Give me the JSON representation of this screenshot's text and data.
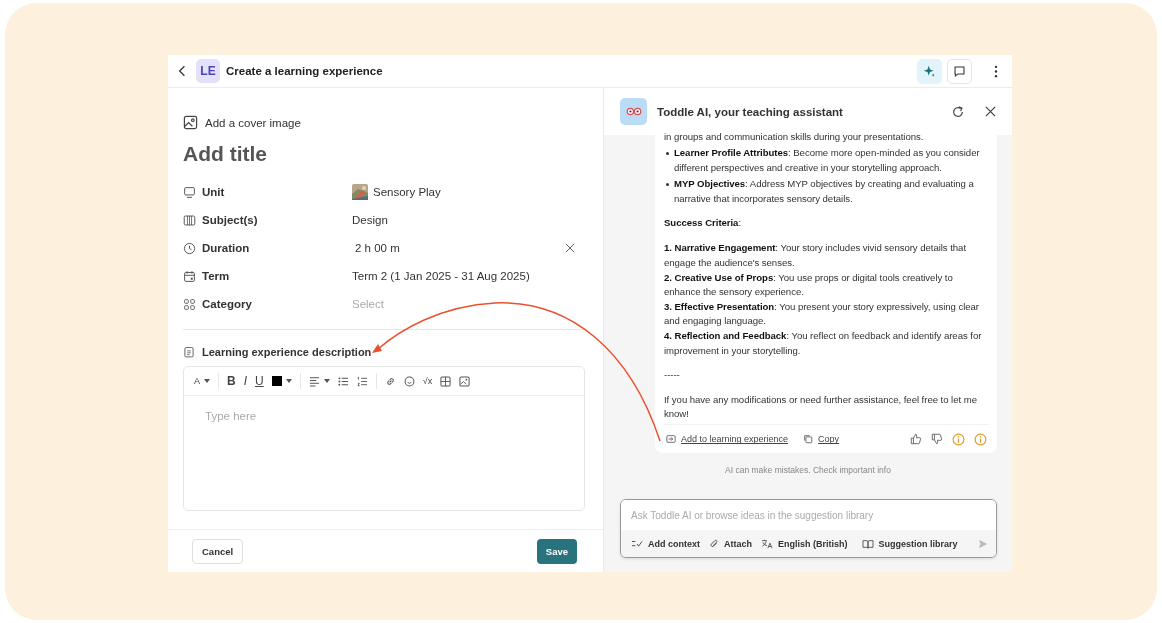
{
  "header": {
    "badge": "LE",
    "title": "Create a learning experience"
  },
  "form": {
    "cover_label": "Add a cover image",
    "title_placeholder": "Add title",
    "fields": [
      {
        "kind": "unit",
        "label": "Unit",
        "value": "Sensory Play"
      },
      {
        "kind": "subject",
        "label": "Subject(s)",
        "value": "Design"
      },
      {
        "kind": "duration",
        "label": "Duration",
        "value": "2 h 00 m"
      },
      {
        "kind": "term",
        "label": "Term",
        "value": "Term 2 (1 Jan 2025 - 31 Aug 2025)"
      },
      {
        "kind": "category",
        "label": "Category",
        "placeholder": "Select"
      }
    ],
    "description_label": "Learning experience description",
    "toolbar": {
      "font": "A",
      "bold": "B",
      "italic": "I",
      "underline": "U",
      "equation": "√x"
    },
    "editor_placeholder": "Type here",
    "cancel": "Cancel",
    "save": "Save"
  },
  "assistant": {
    "title": "Toddle AI, your teaching assistant",
    "message": [
      {
        "kind": "paragraph",
        "text": "in groups and communication skills during your presentations."
      },
      {
        "kind": "bullet",
        "text": "**Learner Profile Attributes**: Become more open-minded as you consider different perspectives and creative in your storytelling approach."
      },
      {
        "kind": "bullet",
        "text": "**MYP Objectives**: Address MYP objectives by creating and evaluating a narrative that incorporates sensory details."
      },
      {
        "kind": "heading",
        "text": "**Success Criteria**:"
      },
      {
        "kind": "numbered",
        "text": "**1. Narrative Engagement**: Your story includes vivid sensory details that engage the audience's senses."
      },
      {
        "kind": "numbered",
        "text": "**2. Creative Use of Props**: You use props or digital tools creatively to enhance the sensory experience."
      },
      {
        "kind": "numbered",
        "text": "**3. Effective Presentation**: You present your story expressively, using clear and engaging language."
      },
      {
        "kind": "numbered",
        "text": "**4. Reflection and Feedback**: You reflect on feedback and identify areas for improvement in your storytelling."
      },
      {
        "kind": "separator",
        "text": "-----"
      },
      {
        "kind": "closing",
        "text": "If you have any modifications or need further assistance, feel free to let me know!"
      }
    ],
    "add_link": "Add to learning experience",
    "copy_link": "Copy",
    "disclaimer": "AI can make mistakes. Check important info",
    "input_placeholder": "Ask Toddle AI or browse ideas in the suggestion library",
    "tools": [
      {
        "kind": "context",
        "label": "Add context"
      },
      {
        "kind": "attach",
        "label": "Attach"
      },
      {
        "kind": "language",
        "label": "English (British)"
      },
      {
        "kind": "library",
        "label": "Suggestion library"
      }
    ]
  }
}
